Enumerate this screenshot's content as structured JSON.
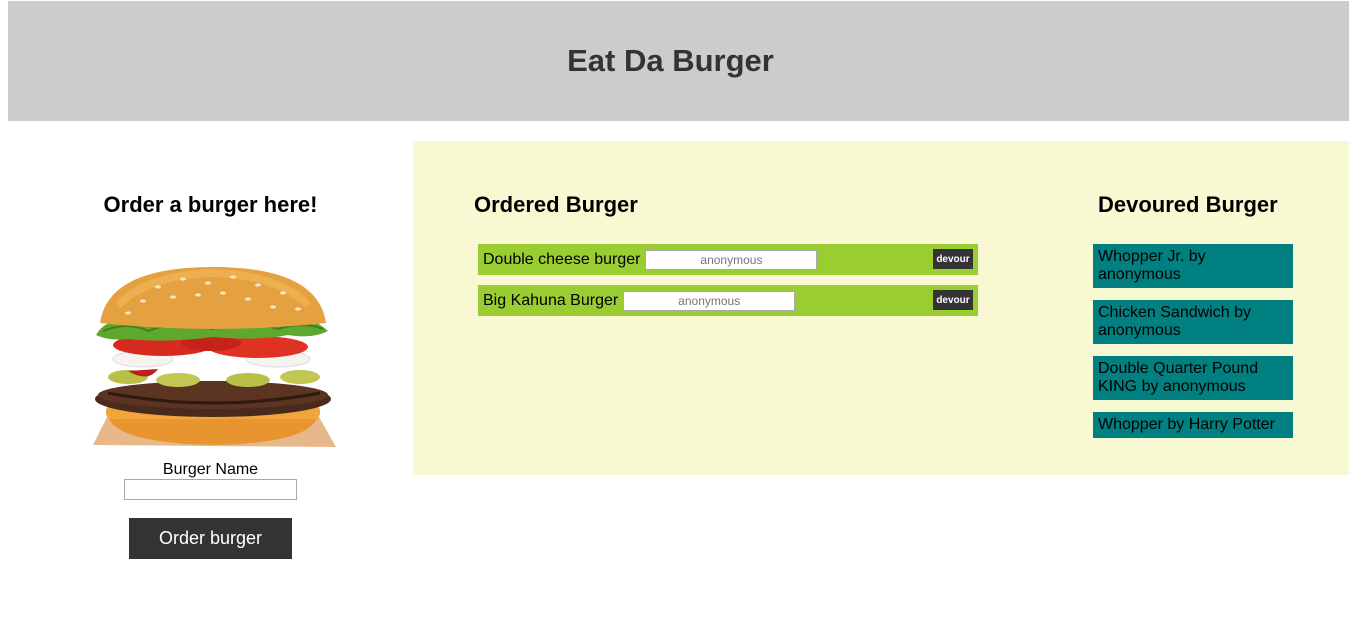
{
  "header": {
    "title": "Eat Da Burger"
  },
  "order_form": {
    "title": "Order a burger here!",
    "image_icon": "burger-image",
    "name_label": "Burger Name",
    "name_value": "",
    "submit_label": "Order burger"
  },
  "ordered": {
    "title": "Ordered Burger",
    "items": [
      {
        "name": "Double cheese burger",
        "placeholder": "anonymous",
        "button": "devour"
      },
      {
        "name": "Big Kahuna Burger",
        "placeholder": "anonymous",
        "button": "devour"
      }
    ]
  },
  "devoured": {
    "title": "Devoured Burger",
    "items": [
      {
        "label": "Whopper Jr. by anonymous"
      },
      {
        "label": "Chicken Sandwich by anonymous"
      },
      {
        "label": "Double Quarter Pound KING by anonymous"
      },
      {
        "label": "Whopper by Harry Potter"
      }
    ]
  },
  "colors": {
    "header_bg": "#cccccc",
    "panel_bg": "#f8f9d2",
    "ordered_bg": "#9acd32",
    "devoured_bg": "#008080",
    "button_bg": "#333333"
  }
}
